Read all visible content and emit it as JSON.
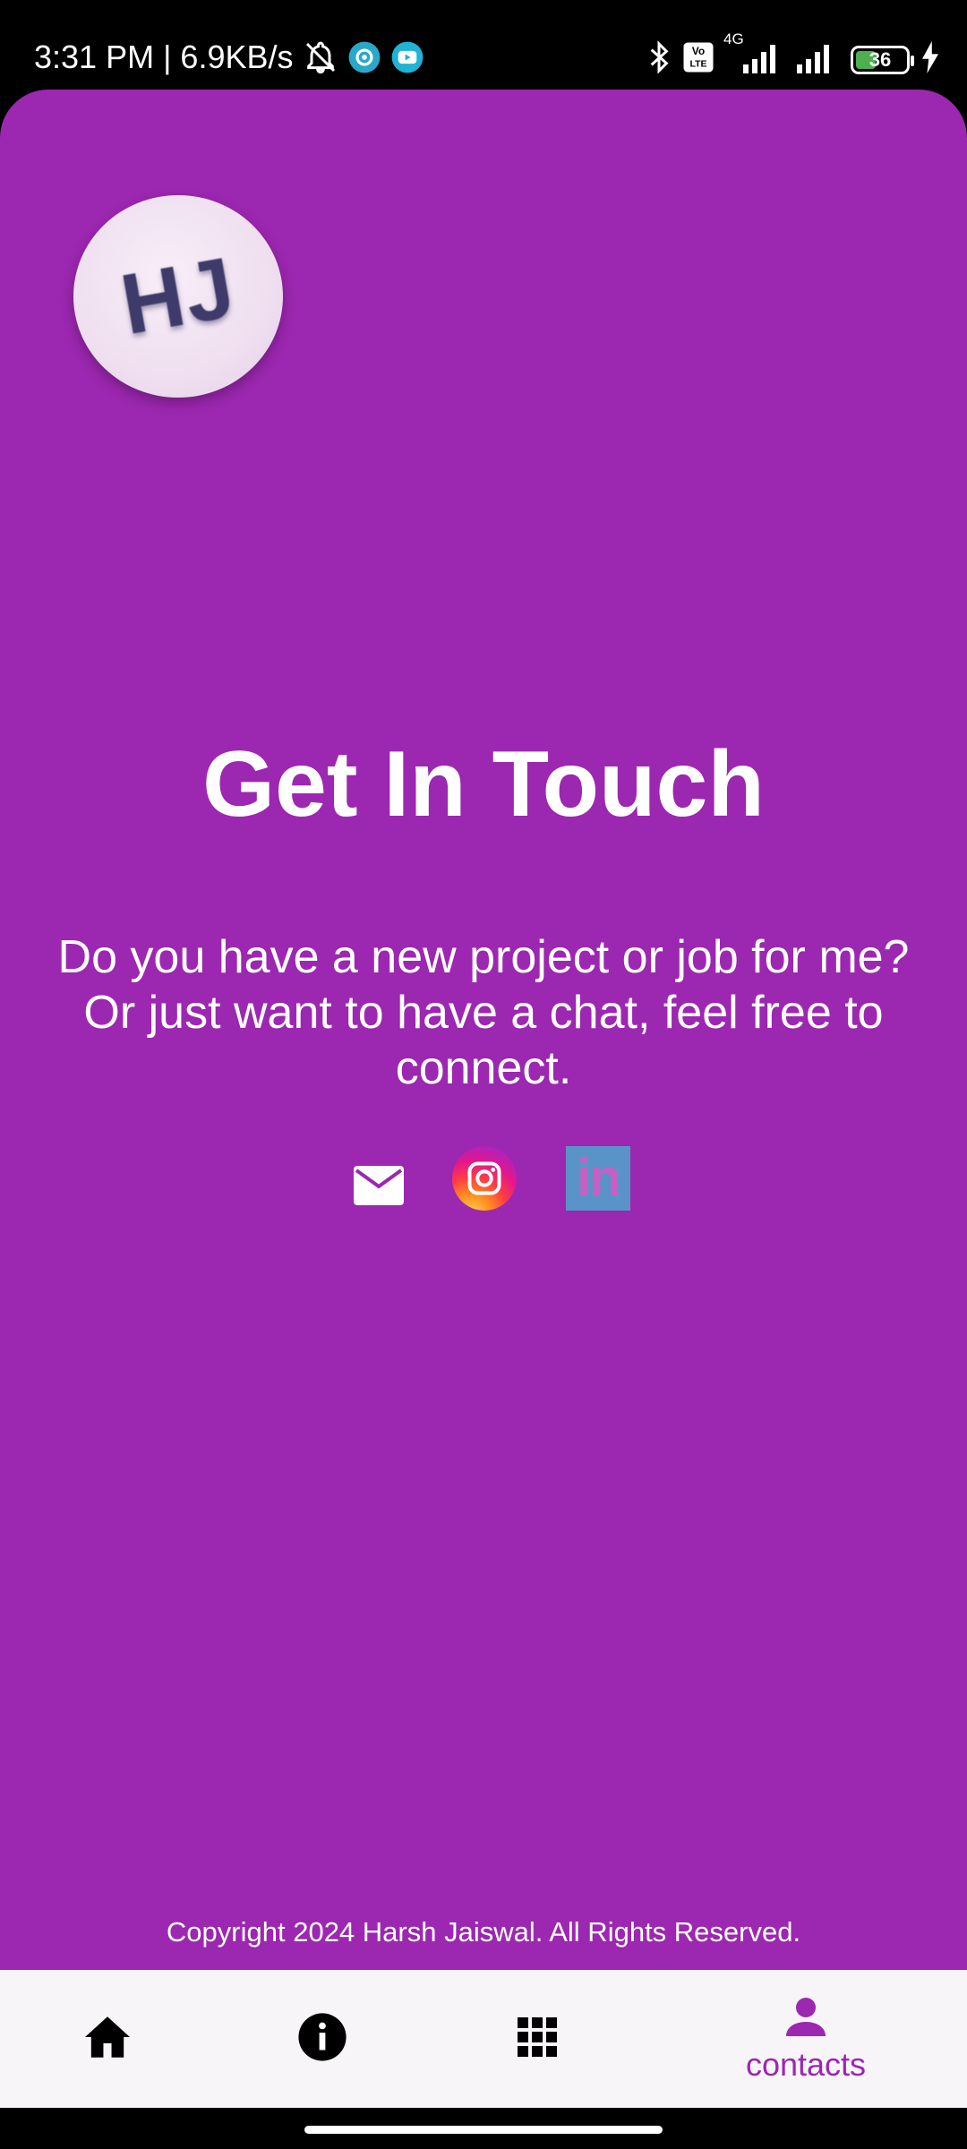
{
  "status_bar": {
    "time_speed": "3:31 PM | 6.9KB/s",
    "network_label": "4G",
    "volte_label": "Vo LTE",
    "battery_level": "36",
    "icons": [
      "bell-off-icon",
      "settings-app-icon",
      "youtube-app-icon",
      "bluetooth-icon",
      "volte-icon",
      "signal-icon",
      "signal-icon",
      "battery-icon",
      "charging-icon"
    ]
  },
  "profile": {
    "initials": "HJ"
  },
  "contact": {
    "heading": "Get In Touch",
    "subtext": "Do you have a new project or job for me? Or just want to have a  chat, feel free to connect."
  },
  "social_links": [
    "email-icon",
    "instagram-icon",
    "linkedin-icon"
  ],
  "linkedin_label": "in",
  "footer": {
    "copyright": "Copyright 2024 Harsh Jaiswal. All Rights Reserved."
  },
  "bottom_nav": {
    "items": [
      {
        "icon": "home-icon",
        "label": ""
      },
      {
        "icon": "info-icon",
        "label": ""
      },
      {
        "icon": "grid-icon",
        "label": ""
      },
      {
        "icon": "person-icon",
        "label": "contacts"
      }
    ],
    "active_color": "#9c27b0"
  },
  "colors": {
    "background": "#9c27b0",
    "nav_background": "#f8f5f9"
  }
}
